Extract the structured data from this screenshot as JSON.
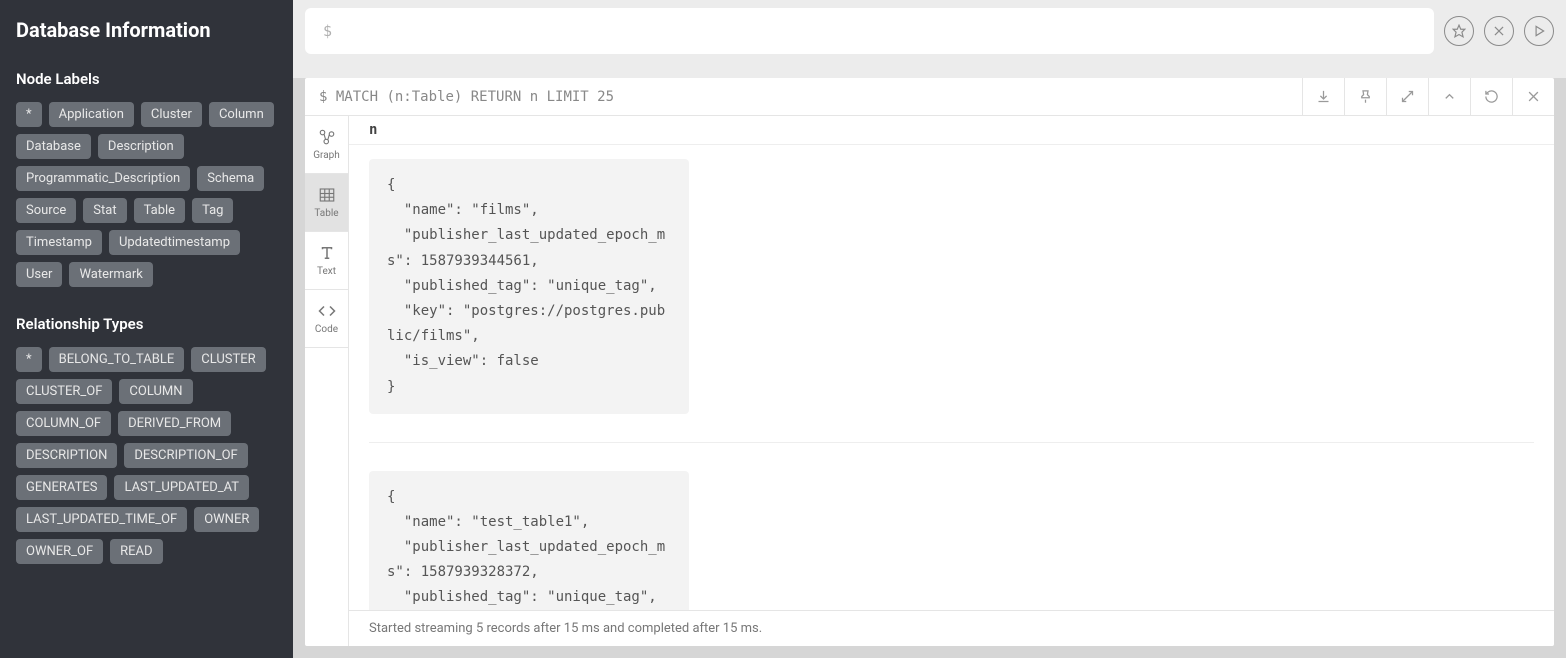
{
  "sidebar": {
    "title": "Database Information",
    "node_labels_heading": "Node Labels",
    "node_labels": [
      "*",
      "Application",
      "Cluster",
      "Column",
      "Database",
      "Description",
      "Programmatic_Description",
      "Schema",
      "Source",
      "Stat",
      "Table",
      "Tag",
      "Timestamp",
      "Updatedtimestamp",
      "User",
      "Watermark"
    ],
    "relationship_types_heading": "Relationship Types",
    "relationship_types": [
      "*",
      "BELONG_TO_TABLE",
      "CLUSTER",
      "CLUSTER_OF",
      "COLUMN",
      "COLUMN_OF",
      "DERIVED_FROM",
      "DESCRIPTION",
      "DESCRIPTION_OF",
      "GENERATES",
      "LAST_UPDATED_AT",
      "LAST_UPDATED_TIME_OF",
      "OWNER",
      "OWNER_OF",
      "READ"
    ]
  },
  "query_bar": {
    "prompt": "$",
    "value": ""
  },
  "result": {
    "executed_prompt": "$",
    "executed_query": "MATCH (n:Table) RETURN n LIMIT 25",
    "view_tabs": {
      "graph": "Graph",
      "table": "Table",
      "text": "Text",
      "code": "Code",
      "active": "table"
    },
    "column_header": "n",
    "records": [
      "{\n  \"name\": \"films\",\n  \"publisher_last_updated_epoch_ms\": 1587939344561,\n  \"published_tag\": \"unique_tag\",\n  \"key\": \"postgres://postgres.public/films\",\n  \"is_view\": false\n}",
      "{\n  \"name\": \"test_table1\",\n  \"publisher_last_updated_epoch_ms\": 1587939328372,\n  \"published_tag\": \"unique_tag\","
    ],
    "status": "Started streaming 5 records after 15 ms and completed after 15 ms."
  }
}
